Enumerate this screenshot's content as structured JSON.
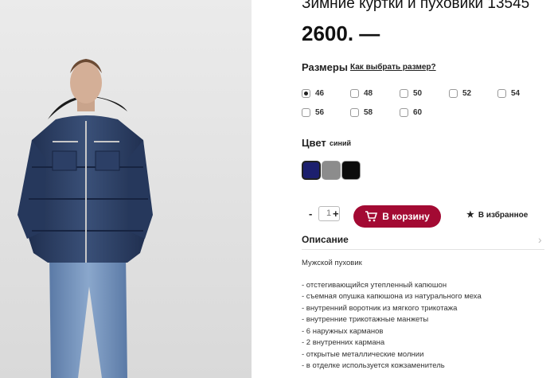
{
  "product": {
    "title": "Зимние куртки и пуховики 13545",
    "price": "2600. —"
  },
  "sizes": {
    "label": "Размеры",
    "help_link": "Как выбрать размер?",
    "options": [
      "46",
      "48",
      "50",
      "52",
      "54",
      "56",
      "58",
      "60"
    ],
    "selected": "46"
  },
  "color": {
    "label": "Цвет",
    "value": "синий",
    "swatches": [
      "#1c1f6e",
      "#8c8c8c",
      "#0c0c0c"
    ]
  },
  "quantity": {
    "minus": "-",
    "value": "1",
    "plus": "+"
  },
  "actions": {
    "cart_label": "В корзину",
    "favorite_label": "В избранное"
  },
  "description": {
    "header": "Описание",
    "intro": "Мужской пуховик",
    "items": [
      "- отстегивающийся утепленный капюшон",
      "- съемная опушка капюшона из натурального меха",
      "- внутренний воротник из мягкого трикотажа",
      "- внутренние трикотажные манжеты",
      "- 6 наружных карманов",
      "- 2 внутренних кармана",
      "- открытые металлические молнии",
      "- в отделке используется кожзаменитель"
    ]
  },
  "colors": {
    "accent": "#a30a33"
  }
}
